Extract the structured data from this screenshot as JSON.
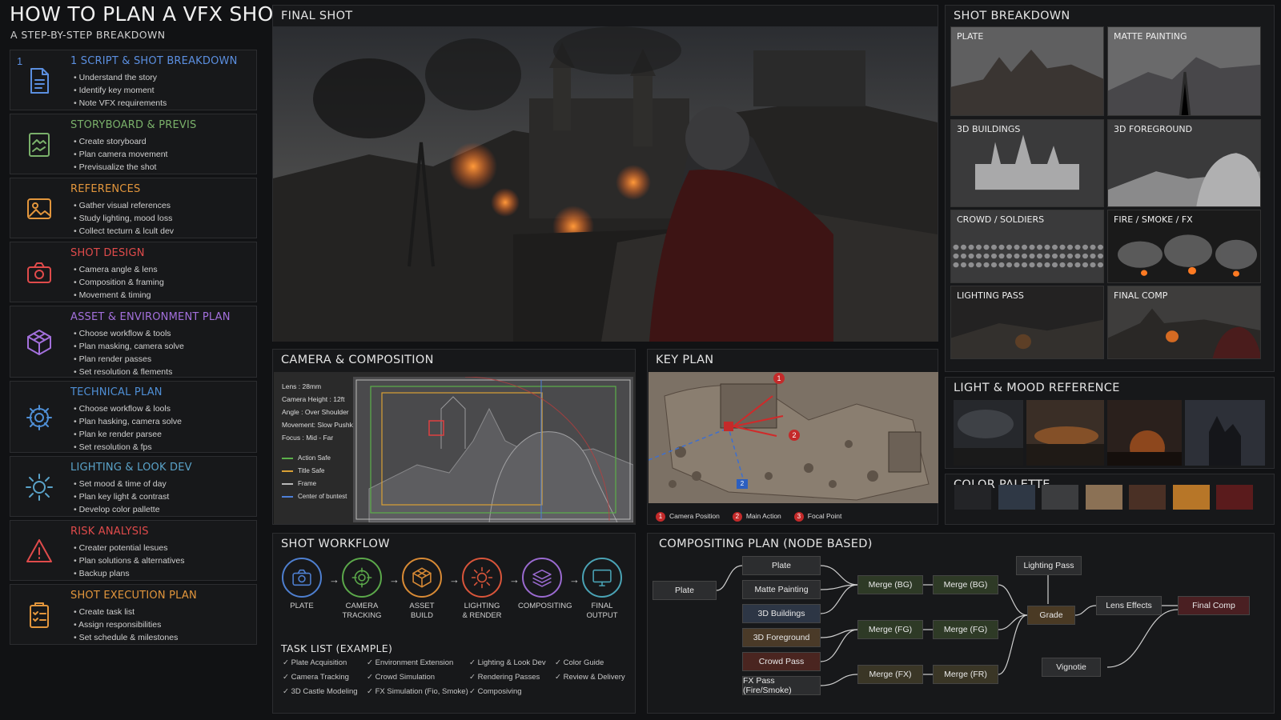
{
  "title": "HOW TO PLAN A VFX SHOT",
  "subtitle": "A STEP-BY-STEP BREAKDOWN",
  "steps": [
    {
      "num": "1",
      "title": "1 SCRIPT & SHOT BREAKDOWN",
      "color": "#5b8fe0",
      "icon": "document-icon",
      "items": [
        "Understand the story",
        "Identify key moment",
        "Note VFX requirements"
      ]
    },
    {
      "title": "STORYBOARD & PREVIS",
      "color": "#7ab06a",
      "icon": "storyboard-icon",
      "items": [
        "Create storyboard",
        "Plan camera movement",
        "Previsualize the shot"
      ]
    },
    {
      "title": "REFERENCES",
      "color": "#e3963c",
      "icon": "image-icon",
      "items": [
        "Gather visual references",
        "Study lighting, mood loss",
        "Collect tecturn & lcult dev"
      ]
    },
    {
      "title": "SHOT DESIGN",
      "color": "#e04b4b",
      "icon": "camera-icon",
      "items": [
        "Camera angle & lens",
        "Composition & framing",
        "Movement & timing"
      ]
    },
    {
      "title": "ASSET & ENVIRONMENT PLAN",
      "color": "#a370dc",
      "icon": "cube-icon",
      "items": [
        "Choose workflow & tools",
        "Plan masking, camera solve",
        "Plan render passes",
        "Set resolution & flements"
      ]
    },
    {
      "title": "TECHNICAL PLAN",
      "color": "#4f8fd6",
      "icon": "gear-icon",
      "items": [
        "Choose workflow & lools",
        "Plan hasking, camera solve",
        "Plan ke render parsee",
        "Set resolution & fps"
      ]
    },
    {
      "title": "LIGHTING & LOOK DEV",
      "color": "#5aa3c9",
      "icon": "sun-icon",
      "items": [
        "Set mood & time of day",
        "Plan key light & contrast",
        "Develop color pallette"
      ]
    },
    {
      "title": "RISK ANALYSIS",
      "color": "#e04b4b",
      "icon": "warning-icon",
      "items": [
        "Creater potential lesues",
        "Plan solutions & alternatives",
        "Backup plans"
      ]
    },
    {
      "title": "SHOT EXECUTION PLAN",
      "color": "#e3963c",
      "icon": "clipboard-icon",
      "items": [
        "Create task list",
        "Assign responsibilities",
        "Set schedule & milestones"
      ]
    }
  ],
  "final_shot": {
    "title": "FINAL SHOT"
  },
  "breakdown": {
    "title": "SHOT BREAKDOWN",
    "tiles": [
      "PLATE",
      "MATTE PAINTING",
      "3D BUILDINGS",
      "3D FOREGROUND",
      "CROWD / SOLDIERS",
      "FIRE / SMOKE / FX",
      "LIGHTING PASS",
      "FINAL COMP"
    ]
  },
  "camera": {
    "title": "CAMERA & COMPOSITION",
    "specs": [
      "Lens : 28mm",
      "Camera Height : 12ft",
      "Angle : Over Shoulder",
      "Movement: Slow Pushk",
      "Focus : Mid - Far"
    ],
    "legend": [
      {
        "label": "Action Safe",
        "color": "#5bb04a"
      },
      {
        "label": "Title Safe",
        "color": "#d9a035"
      },
      {
        "label": "Frame",
        "color": "#b9b9b9"
      },
      {
        "label": "Center of buntest",
        "color": "#4d7fd8"
      }
    ]
  },
  "keyplan": {
    "title": "KEY PLAN",
    "markers": [
      "1",
      "2",
      "2"
    ],
    "legend": [
      {
        "n": "1",
        "label": "Camera Position"
      },
      {
        "n": "2",
        "label": "Main Action"
      },
      {
        "n": "3",
        "label": "Focal Point"
      }
    ]
  },
  "mood": {
    "title": "LIGHT & MOOD REFERENCE"
  },
  "palette": {
    "title": "COLOR PALETTE",
    "colors": [
      "#232427",
      "#2f3845",
      "#3c3d3f",
      "#8b7155",
      "#4a3025",
      "#b77628",
      "#5a1b1c"
    ]
  },
  "workflow": {
    "title": "SHOT WORKFLOW",
    "stages": [
      {
        "label": "PLATE",
        "color": "#4e7fd0",
        "icon": "camera-icon"
      },
      {
        "label": "CAMERA\nTRACKING",
        "color": "#5ba84a",
        "icon": "target-icon"
      },
      {
        "label": "ASSET\nBUILD",
        "color": "#d88a35",
        "icon": "cube-icon"
      },
      {
        "label": "LIGHTING\n& RENDER",
        "color": "#d9553a",
        "icon": "sun-icon"
      },
      {
        "label": "COMPOSITING",
        "color": "#9a6ad0",
        "icon": "layers-icon"
      },
      {
        "label": "FINAL\nOUTPUT",
        "color": "#4aa3b5",
        "icon": "monitor-icon"
      }
    ]
  },
  "tasks": {
    "title": "TASK LIST (EXAMPLE)",
    "items": [
      "Plate Acquisition",
      "Environment Extension",
      "Lighting & Look Dev",
      "Color Guide",
      "Camera Tracking",
      "Crowd Simulation",
      "Rendering Passes",
      "Review & Delivery",
      "3D Castle Modeling",
      "FX Simulation (Fio, Smoke)",
      "Composiving"
    ]
  },
  "comp": {
    "title": "COMPOSITING PLAN (NODE BASED)",
    "nodes": {
      "plate_in": "Plate",
      "plate": "Plate",
      "matte": "Matte Painting",
      "bld": "3D Buildings",
      "fg": "3D Foreground",
      "crowd": "Crowd Pass",
      "fx": "FX Pass (Fire/Smoke)",
      "mbg1": "Merge (BG)",
      "mbg2": "Merge (BG)",
      "mfg1": "Merge (FG)",
      "mfg2": "Merge (FG)",
      "mfx1": "Merge (FX)",
      "mfx2": "Merge (FR)",
      "lp": "Lighting Pass",
      "grade": "Grade",
      "lens": "Lens Effects",
      "final": "Final Comp",
      "vig": "Vignotie"
    }
  }
}
